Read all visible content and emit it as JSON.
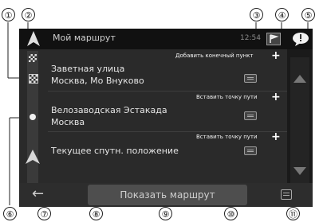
{
  "callouts": {
    "c1": "①",
    "c2": "②",
    "c3": "③",
    "c4": "④",
    "c5": "⑤",
    "c6": "⑥",
    "c7": "⑦",
    "c8": "⑧",
    "c9": "⑨",
    "c10": "⑩",
    "c11": "⑪"
  },
  "header": {
    "title": "Мой маршрут",
    "time": "12:54"
  },
  "route": {
    "add_destination_label": "Добавить конечный пункт",
    "waypoints": [
      {
        "line1": "Заветная улица",
        "line2": "Москва, Мо Внуково"
      },
      {
        "line1": "Велозаводская Эстакада",
        "line2": "Москва"
      },
      {
        "line1": "Текущее спутн. положение",
        "line2": ""
      }
    ],
    "insert_waypoint_label": "Вставить точку пути",
    "plus_symbol": "+"
  },
  "footer": {
    "show_route_label": "Показать маршрут",
    "back_symbol": "←"
  },
  "colors": {
    "screen_bg": "#1a1a1a",
    "row_bg": "#2a2a2a",
    "button_bg": "#4e4e4e",
    "text": "#e6e6e6"
  },
  "icons": [
    "app-logo-icon",
    "flag-icon",
    "chat-icon",
    "finish-flag-icon",
    "route-marker-icon",
    "current-position-arrow-icon",
    "note-icon",
    "scroll-up-icon",
    "scroll-down-icon",
    "back-arrow-icon",
    "menu-icon"
  ]
}
